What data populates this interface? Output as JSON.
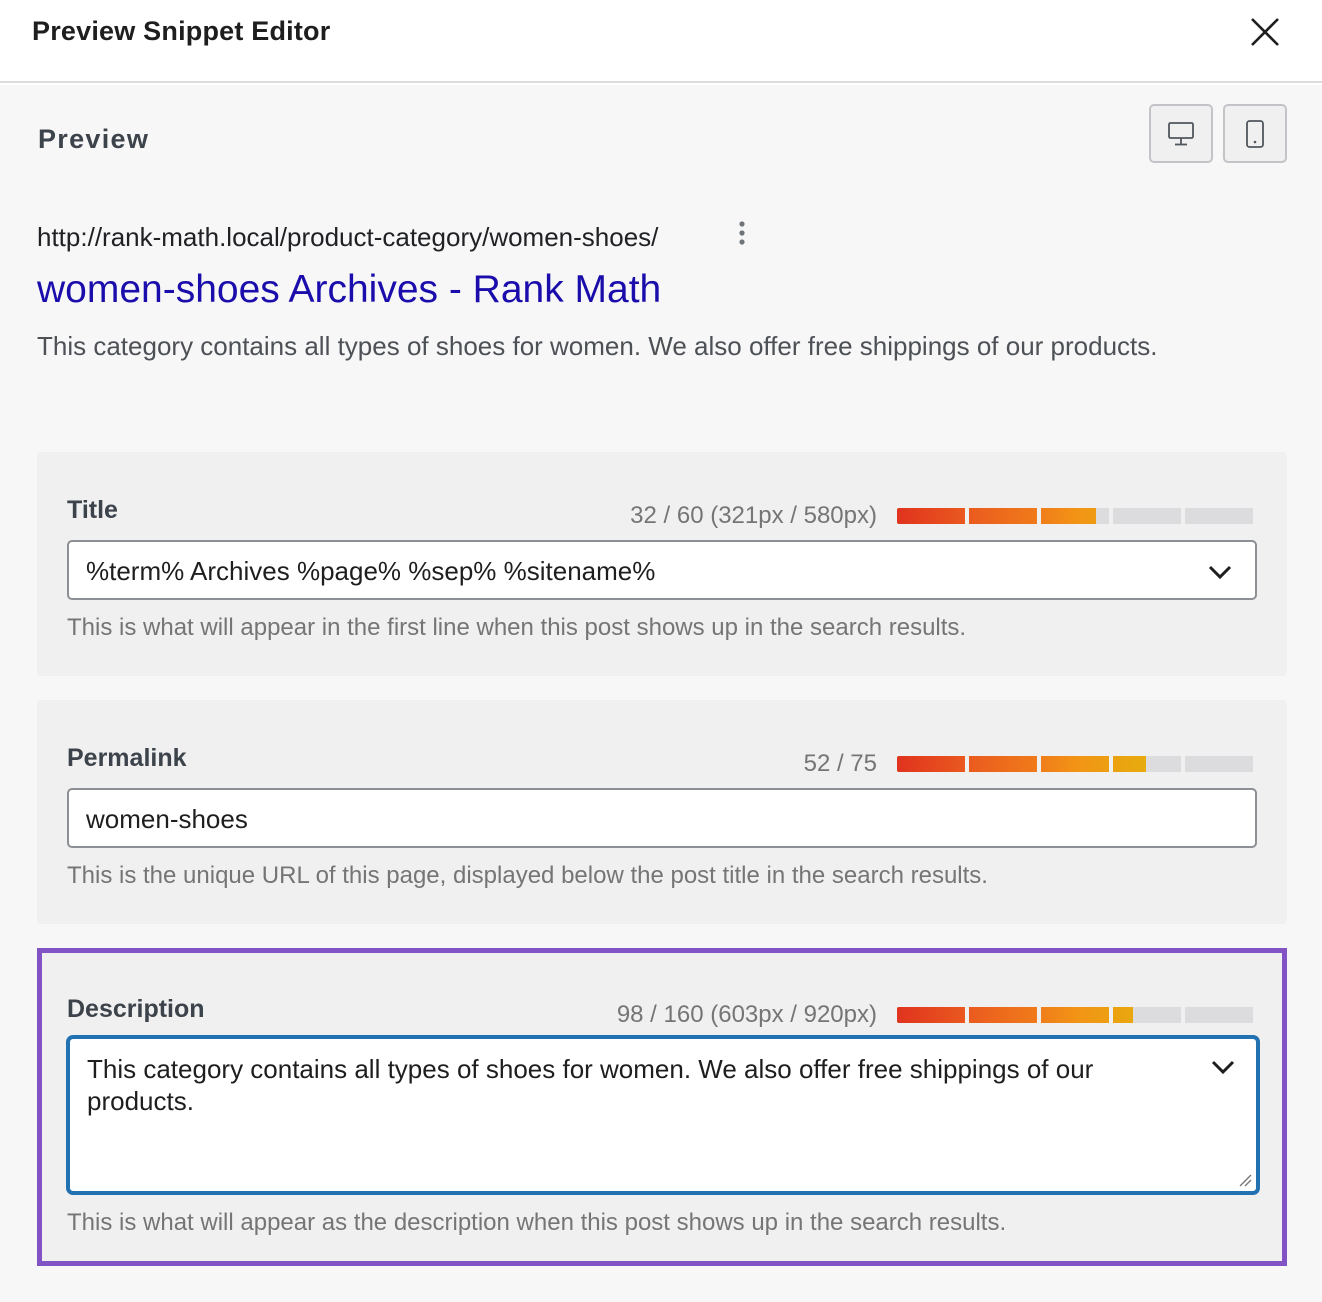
{
  "header": {
    "title": "Preview Snippet Editor",
    "close_icon": "close-icon"
  },
  "preview": {
    "heading": "Preview",
    "device_buttons": [
      {
        "icon": "desktop-icon",
        "active": true
      },
      {
        "icon": "mobile-icon",
        "active": false
      }
    ],
    "serp": {
      "url": "http://rank-math.local/product-category/women-shoes/",
      "title": "women-shoes Archives - Rank Math",
      "description": "This category contains all types of shoes for women. We also offer free shippings of our products.",
      "menu_icon": "more-vertical-icon"
    }
  },
  "fields": {
    "title": {
      "label": "Title",
      "counter": "32 / 60 (321px / 580px)",
      "progress": 0.553,
      "value": "%term% Archives %page% %sep% %sitename%",
      "help": "This is what will appear in the first line when this post shows up in the search results."
    },
    "permalink": {
      "label": "Permalink",
      "counter": "52 / 75",
      "progress": 0.693,
      "value": "women-shoes",
      "help": "This is the unique URL of this page, displayed below the post title in the search results."
    },
    "description": {
      "label": "Description",
      "counter": "98 / 160 (603px / 920px)",
      "progress": 0.655,
      "value": "This category contains all types of shoes for women. We also offer free shippings of our products.",
      "help": "This is what will appear as the description when this post shows up in the search results."
    }
  },
  "colors": {
    "serp_title": "#1a0dab",
    "focus_border": "#2271b1",
    "highlight_border": "#8253c4"
  }
}
